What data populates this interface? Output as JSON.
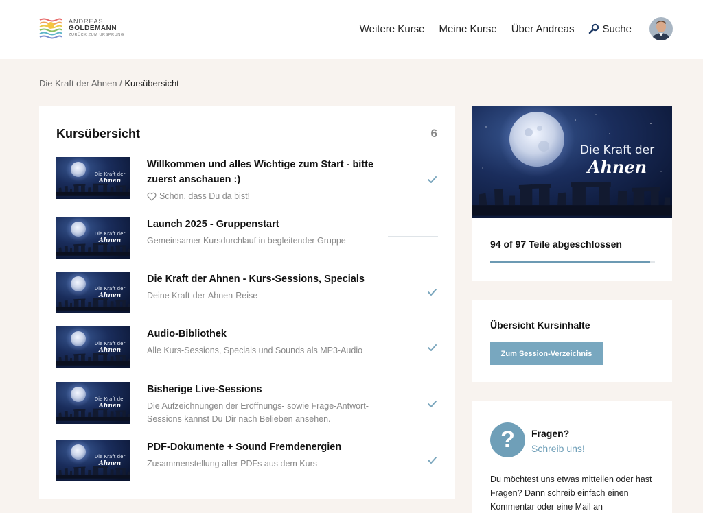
{
  "header": {
    "logo": {
      "line1": "ANDREAS",
      "line2": "GOLDEMANN",
      "line3": "ZURÜCK ZUM URSPRUNG"
    },
    "nav": {
      "courses_more": "Weitere Kurse",
      "my_courses": "Meine Kurse",
      "about": "Über Andreas",
      "search": "Suche"
    }
  },
  "breadcrumb": {
    "parent": "Die Kraft der Ahnen",
    "separator": " / ",
    "current": "Kursübersicht"
  },
  "main": {
    "title": "Kursübersicht",
    "count": "6",
    "thumb_caption_line1": "Die Kraft der",
    "thumb_caption_line2": "Ahnen",
    "items": [
      {
        "title": "Willkommen und alles Wichtige zum Start - bitte zuerst anschauen :)",
        "subtitle": "Schön, dass Du da bist!",
        "status": "complete"
      },
      {
        "title": "Launch 2025 - Gruppenstart",
        "subtitle": "Gemeinsamer Kursdurchlauf in begleitender Gruppe",
        "status": "in-progress",
        "progress": 0
      },
      {
        "title": "Die Kraft der Ahnen - Kurs-Sessions, Specials",
        "subtitle": "Deine Kraft-der-Ahnen-Reise",
        "status": "complete"
      },
      {
        "title": "Audio-Bibliothek",
        "subtitle": "Alle Kurs-Sessions, Specials und Sounds als MP3-Audio",
        "status": "complete"
      },
      {
        "title": "Bisherige Live-Sessions",
        "subtitle": "Die Aufzeichnungen der Eröffnungs- sowie Frage-Antwort-Sessions kannst Du Dir nach Belieben ansehen.",
        "status": "complete"
      },
      {
        "title": "PDF-Dokumente + Sound Fremdenergien",
        "subtitle": "Zusammenstellung aller PDFs aus dem Kurs",
        "status": "complete"
      }
    ]
  },
  "sidebar": {
    "hero": {
      "line1": "Die Kraft der",
      "line2": "Ahnen"
    },
    "progress": {
      "text": "94 of 97 Teile abgeschlossen",
      "completed": 94,
      "total": 97
    },
    "overview": {
      "title": "Übersicht Kursinhalte",
      "button": "Zum Session-Verzeichnis"
    },
    "help": {
      "icon": "?",
      "title": "Fragen?",
      "link": "Schreib uns!",
      "body": "Du möchtest uns etwas mitteilen oder hast Fragen? Dann schreib einfach einen Kommentar oder eine Mail an"
    }
  },
  "colors": {
    "accent": "#6f9fb8",
    "button": "#78a7bf",
    "page_bg": "#f8f3ef",
    "check": "#7aa6bd",
    "night_sky": "#16244a"
  }
}
